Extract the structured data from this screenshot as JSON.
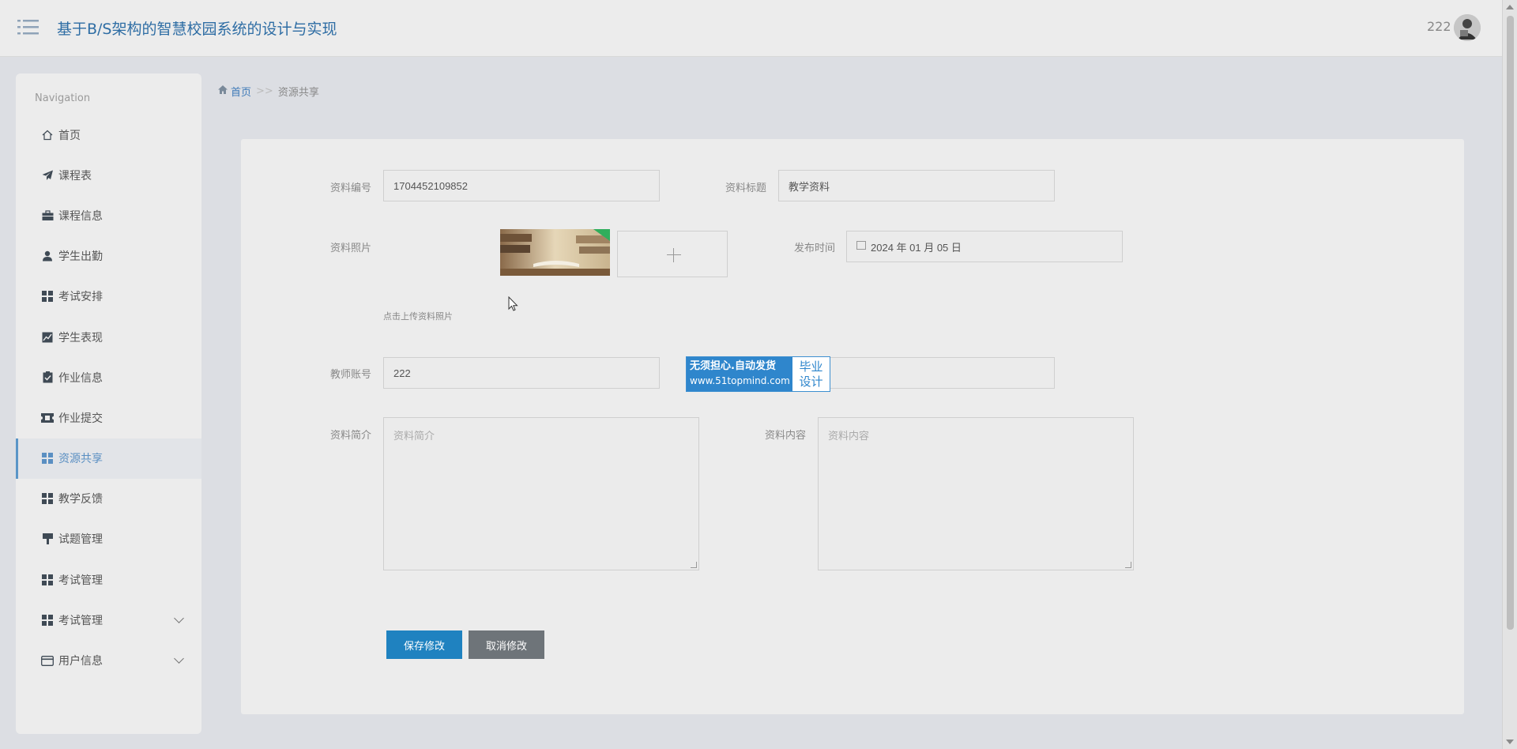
{
  "header": {
    "title": "基于B/S架构的智慧校园系统的设计与实现",
    "user": "222"
  },
  "sidebar": {
    "label": "Navigation",
    "items": [
      {
        "label": "首页",
        "icon": "home-icon"
      },
      {
        "label": "课程表",
        "icon": "paper-plane-icon"
      },
      {
        "label": "课程信息",
        "icon": "briefcase-icon"
      },
      {
        "label": "学生出勤",
        "icon": "user-icon"
      },
      {
        "label": "考试安排",
        "icon": "grid-icon"
      },
      {
        "label": "学生表现",
        "icon": "line-chart-icon"
      },
      {
        "label": "作业信息",
        "icon": "clipboard-check-icon"
      },
      {
        "label": "作业提交",
        "icon": "ticket-icon"
      },
      {
        "label": "资源共享",
        "icon": "grid-icon",
        "active": true
      },
      {
        "label": "教学反馈",
        "icon": "grid-icon"
      },
      {
        "label": "试题管理",
        "icon": "podium-icon"
      },
      {
        "label": "考试管理",
        "icon": "grid-icon"
      },
      {
        "label": "考试管理",
        "icon": "grid-icon",
        "expandable": true
      },
      {
        "label": "用户信息",
        "icon": "card-icon",
        "expandable": true
      }
    ]
  },
  "breadcrumb": {
    "home": "首页",
    "separator": ">>",
    "current": "资源共享"
  },
  "form": {
    "code_label": "资料编号",
    "code_value": "1704452109852",
    "title_label": "资料标题",
    "title_value": "教学资料",
    "photo_label": "资料照片",
    "photo_hint": "点击上传资料照片",
    "publish_label": "发布时间",
    "publish_value": "2024 年 01 月 05 日",
    "teacher_label": "教师账号",
    "teacher_value": "222",
    "intro_label": "资料简介",
    "intro_placeholder": "资料简介",
    "content_label": "资料内容",
    "content_placeholder": "资料内容",
    "save_label": "保存修改",
    "cancel_label": "取消修改"
  },
  "watermark": {
    "line1": "无须担心.自动发货",
    "line2": "www.51topmind.com",
    "badge": "毕业设计"
  },
  "colors": {
    "primary": "#1f82c0",
    "title": "#2e6da4",
    "cancel": "#6e7479"
  }
}
